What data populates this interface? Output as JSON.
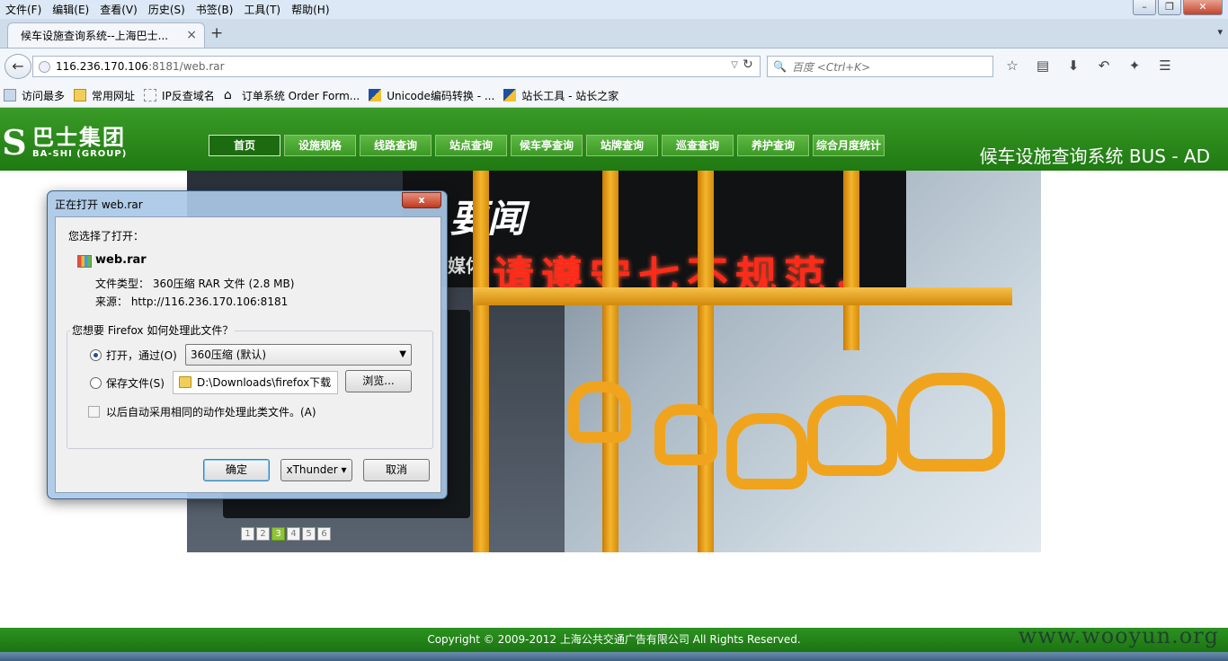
{
  "browser": {
    "menu": [
      "文件(F)",
      "编辑(E)",
      "查看(V)",
      "历史(S)",
      "书签(B)",
      "工具(T)",
      "帮助(H)"
    ],
    "tab_title": "候车设施查询系统--上海巴士...",
    "tab_close": "×",
    "new_tab": "+",
    "url_host": "116.236.170.106",
    "url_rest": ":8181/web.rar",
    "search_placeholder": "百度 <Ctrl+K>",
    "bookmarks": [
      "访问最多",
      "常用网址",
      "IP反查域名",
      "订单系统 Order Form...",
      "Unicode编码转换 - ...",
      "站长工具 - 站长之家"
    ]
  },
  "site": {
    "logo_cn": "巴士集团",
    "logo_en": "BA-SHI (GROUP)",
    "nav": [
      "首页",
      "设施规格",
      "线路查询",
      "站点查询",
      "候车亭查询",
      "站牌查询",
      "巡查查询",
      "养护查询",
      "综合月度统计"
    ],
    "system_title": "候车设施查询系统  BUS - AD",
    "banner": {
      "sign_text": "要闻",
      "media_text": "媒体",
      "led_text": "请遵守七不规范，",
      "pages": [
        "1",
        "2",
        "3",
        "4",
        "5",
        "6"
      ],
      "active_page": "3"
    },
    "footer": "Copyright © 2009-2012 上海公共交通广告有限公司 All Rights Reserved.",
    "watermark": "www.wooyun.org"
  },
  "dialog": {
    "title": "正在打开 web.rar",
    "close": "x",
    "you_chose": "您选择了打开：",
    "filename": "web.rar",
    "file_type": "文件类型： 360压缩 RAR 文件 (2.8 MB)",
    "source": "来源： http://116.236.170.106:8181",
    "question": "您想要 Firefox 如何处理此文件？",
    "open_with_label": "打开，通过(O)",
    "open_with_value": "360压缩 (默认)",
    "save_label": "保存文件(S)",
    "save_path": "D:\\Downloads\\firefox下载",
    "browse": "浏览...",
    "auto_label": "以后自动采用相同的动作处理此类文件。(A)",
    "ok": "确定",
    "xthunder": "xThunder ▾",
    "cancel": "取消"
  }
}
